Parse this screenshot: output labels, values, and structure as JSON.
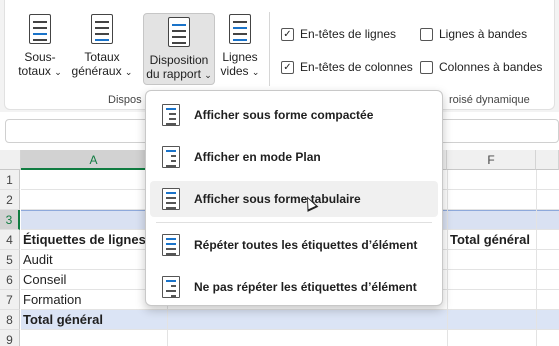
{
  "ribbon": {
    "buttons": {
      "subtotals": {
        "line1": "Sous-",
        "line2": "totaux",
        "chevron": "⌄"
      },
      "grand_totals": {
        "line1": "Totaux",
        "line2": "généraux",
        "chevron": "⌄"
      },
      "report_layout": {
        "line1": "Disposition",
        "line2": "du rapport",
        "chevron": "⌄"
      },
      "blank_rows": {
        "line1": "Lignes",
        "line2": "vides",
        "chevron": "⌄"
      }
    },
    "checkboxes": {
      "row_headers": {
        "label": "En-têtes de lignes",
        "checked": true,
        "mark": "✓"
      },
      "column_headers": {
        "label": "En-têtes de colonnes",
        "checked": true,
        "mark": "✓"
      },
      "banded_rows": {
        "label": "Lignes à bandes",
        "checked": false
      },
      "banded_columns": {
        "label": "Colonnes à bandes",
        "checked": false
      }
    },
    "group_labels": {
      "layout": "Dispos",
      "style_options": "roisé dynamique"
    }
  },
  "grid": {
    "columns": {
      "a": "A",
      "f": "F"
    },
    "rows": [
      "1",
      "2",
      "3",
      "4",
      "5",
      "6",
      "7",
      "8",
      "9"
    ],
    "cells": {
      "row_labels_header": "Étiquettes de lignes",
      "grand_total_header": "Total général",
      "item1": "Audit",
      "item2": "Conseil",
      "item3": "Formation",
      "grand_total_row": "Total général"
    }
  },
  "menu": {
    "items": [
      {
        "label": "Afficher sous forme compactée",
        "icon": "compact-layout-icon"
      },
      {
        "label": "Afficher en mode Plan",
        "icon": "outline-layout-icon"
      },
      {
        "label": "Afficher sous forme tabulaire",
        "icon": "tabular-layout-icon",
        "hovered": true
      },
      {
        "label": "Répéter toutes les étiquettes d’élément",
        "icon": "repeat-labels-icon"
      },
      {
        "label": "Ne pas répéter les étiquettes d’élément",
        "icon": "no-repeat-labels-icon"
      }
    ]
  },
  "colors": {
    "accent": "#107c41",
    "band": "#dbe4f5",
    "icon_blue": "#1a73c9"
  }
}
